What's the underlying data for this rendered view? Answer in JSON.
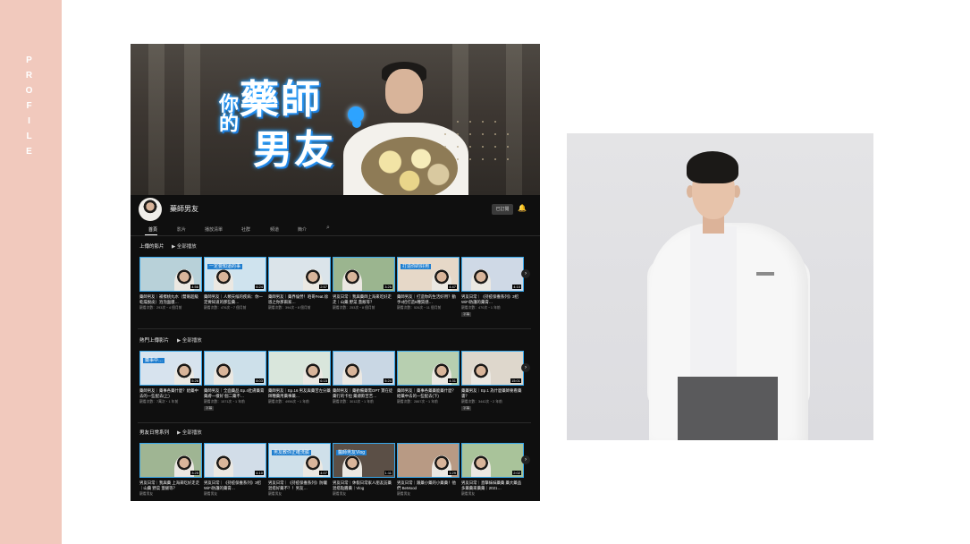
{
  "side": {
    "label": "PROFILE"
  },
  "banner": {
    "logo_line1": "藥師",
    "logo_line2": "你的",
    "logo_line3": "男友"
  },
  "channel": {
    "name": "藥師男友",
    "subscribe": "已訂閱"
  },
  "tabs": [
    "首頁",
    "影片",
    "播放清單",
    "社群",
    "頻道",
    "簡介"
  ],
  "sections": [
    {
      "title": "上傳的影片",
      "play_all": "全部播放",
      "videos": [
        {
          "title": "藥師男友｜補擦桃丸水（雙眼超級乾燥脫皮）泡泡面膜…",
          "meta": "觀看次數：293次・4 個月前",
          "duration": "4:56",
          "caption": "",
          "thumb": "#b8d1d9"
        },
        {
          "title": "藥師男友｜人類天候的疾病：你一定要知道的那些藥…",
          "meta": "觀看次數：476次・7 個月前",
          "duration": "6:24",
          "caption": "一定要知道的事",
          "thumb": "#cfe3ee"
        },
        {
          "title": "藥師男友｜藥界倫勞！咱哥Feat.徐恩之你那兩家…",
          "meta": "觀看次數：394次・8 個月前",
          "duration": "2:57",
          "caption": "",
          "thumb": "#dbe4ea"
        },
        {
          "title": "男友日常｜我與藥師上海來吃好走走｜山藥 野菜 蓋飯等？",
          "meta": "觀看次數：253次・8 個月前",
          "duration": "3:25",
          "caption": "",
          "thumb": "#9bb58f"
        },
        {
          "title": "藥師男友｜打造你的生活好用？動手4招打造6種質感…",
          "meta": "觀看次數：526次・11 個月前",
          "duration": "4:47",
          "caption": "打造你的好用",
          "thumb": "#e6d8c8"
        },
        {
          "title": "男友日常｜《持疫保養系列》3招WiFi防護的藥膏…",
          "meta": "觀看次數：470次・1 年前",
          "duration": "4:10",
          "caption": "",
          "thumb": "#cfd9e6",
          "tag": "字幕"
        }
      ]
    },
    {
      "title": "熱門上傳影片",
      "play_all": "全部播放",
      "videos": [
        {
          "title": "藥師男友｜藥事各藥什麼？給藥中去的一些配去(上)",
          "meta": "觀看次數：7萬次・1 年前",
          "duration": "5:26",
          "caption": "藥事中…",
          "thumb": "#d7e3ee"
        },
        {
          "title": "藥師男友｜全面藥品 Ep.4肚膚藥膏藥膚一樣好 個二藥不…",
          "meta": "觀看次數：1571次・1 年前",
          "duration": "8:03",
          "caption": "",
          "thumb": "#cde0ea",
          "tag": "字幕"
        },
        {
          "title": "藥師男友｜Ep.16 男友與藥苦左分藥師種藥用藥事藥…",
          "meta": "觀看次數：4956次・1 年前",
          "duration": "6:15",
          "caption": "",
          "thumb": "#d9e6dc"
        },
        {
          "title": "藥師男友｜藥勸備藥需OPT 寶在徒藥行的卡拉 藥膚飲苦苦…",
          "meta": "觀看次數：3012次・1 年前",
          "duration": "5:24",
          "caption": "",
          "thumb": "#c9d7e4"
        },
        {
          "title": "藥師男友｜藥事各藥藥能藥什麼？給藥中去的一些配去(下)",
          "meta": "觀看次數：2867次・1 年前",
          "duration": "4:31",
          "caption": "",
          "thumb": "#b7cfb0"
        },
        {
          "title": "藥藥男友｜Ep.1 為什麼藥師要看藥書？",
          "meta": "觀看次數：3442次・2 年前",
          "duration": "15:01",
          "caption": "",
          "thumb": "#ded7cc",
          "tag": "字幕"
        }
      ]
    },
    {
      "title": "男友日常系列",
      "play_all": "全部播放",
      "videos": [
        {
          "title": "男友日常｜我與藥 上海來吃好走走｜山藥 野菜 蓋飯等？",
          "meta": "觀看男友",
          "duration": "3:25",
          "caption": "",
          "thumb": "#9fb593"
        },
        {
          "title": "男友日常｜《持疫保養系列》3招WiFi防護的藥膏…",
          "meta": "觀看男友",
          "duration": "4:10",
          "caption": "",
          "thumb": "#d2dde8"
        },
        {
          "title": "男友日常｜《持疫保養系列》防曬混搭好藥不？！男友…",
          "meta": "觀看男友",
          "duration": "4:07",
          "caption": "男友教你正確洗臉",
          "thumb": "#cfe0ea"
        },
        {
          "title": "男友日常｜休假日常家人朋友訪藥混搭點醬藥｜Vlog",
          "meta": "觀看男友",
          "duration": "1:11",
          "caption": "醫師男友Vlog",
          "thumb": "#5b4f46"
        },
        {
          "title": "男友日常｜跟藥小藥的小藥藥！他們 BeMood",
          "meta": "觀看男友",
          "duration": "1:29",
          "caption": "",
          "thumb": "#b89a84"
        },
        {
          "title": "男友日常｜直擊妹妹藥藥 藥大藥品多藥藥來藥藥｜2021…",
          "meta": "觀看男友",
          "duration": "2:02",
          "caption": "",
          "thumb": "#a9c39a"
        }
      ]
    }
  ],
  "colors": {
    "side": "#f1c9bd",
    "yt_bg": "#0f0f0f",
    "accent": "#38a7ea"
  }
}
